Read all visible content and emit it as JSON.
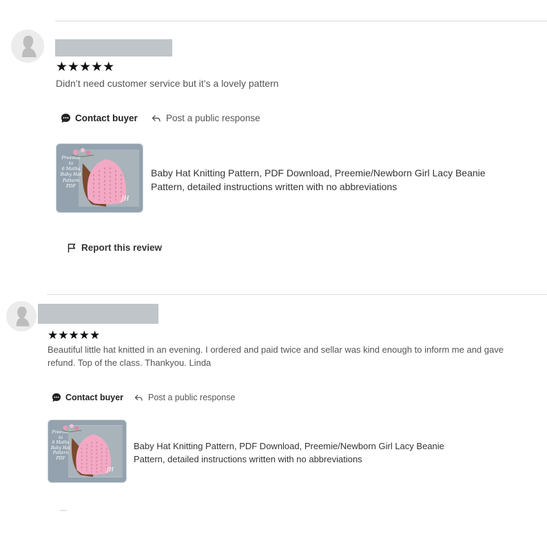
{
  "reviews": [
    {
      "rating": 5,
      "stars": "★★★★★",
      "text": "Didn’t need customer service but it’s a lovely pattern",
      "contact_label": "Contact buyer",
      "respond_label": "Post a public response",
      "listing": {
        "title_line1": "Baby Hat Knitting Pattern, PDF Download, Preemie/Newborn Girl Lacy Beanie",
        "title_line2": "Pattern, detailed instructions written with no abbreviations",
        "thumb_caption": "Preemie\nto\n6 Maths\nBaby Hat\nPattern\nPDF"
      },
      "report_label": "Report this review"
    },
    {
      "rating": 5,
      "stars": "★★★★★",
      "text_line1": "Beautiful little hat knitted in an evening. I ordered and paid twice and sellar was kind enough to inform me and gave",
      "text_line2": "refund. Top of the class. Thankyou. Linda",
      "contact_label": "Contact buyer",
      "respond_label": "Post a public response",
      "listing": {
        "title_line1": "Baby Hat Knitting Pattern, PDF Download, Preemie/Newborn Girl Lacy Beanie",
        "title_line2": "Pattern, detailed instructions written with no abbreviations",
        "thumb_caption": "Preemie\nto\n6 Maths\nBaby Hat\nPattern\nPDF"
      }
    }
  ],
  "colors": {
    "hat_pink": "#f2a9c4",
    "thumb_bg": "#93a2ae",
    "name_redaction": "#bfc5c9"
  }
}
